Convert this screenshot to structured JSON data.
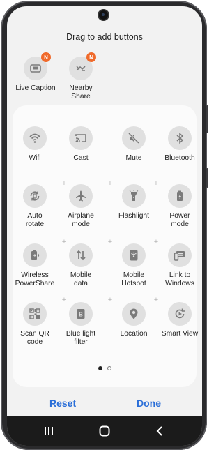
{
  "header": {
    "title": "Drag to add buttons"
  },
  "available": [
    {
      "label_lines": [
        "Live Caption"
      ],
      "badge": "N",
      "icon": "live-caption-icon"
    },
    {
      "label_lines": [
        "Nearby",
        "Share"
      ],
      "badge": "N",
      "icon": "nearby-share-icon"
    }
  ],
  "tiles": [
    {
      "label_lines": [
        "Wifi"
      ],
      "icon": "wifi-icon"
    },
    {
      "label_lines": [
        "Cast"
      ],
      "icon": "cast-icon"
    },
    {
      "label_lines": [
        "Mute"
      ],
      "icon": "mute-icon"
    },
    {
      "label_lines": [
        "Bluetooth"
      ],
      "icon": "bluetooth-icon"
    },
    {
      "label_lines": [
        "Auto",
        "rotate"
      ],
      "icon": "auto-rotate-icon"
    },
    {
      "label_lines": [
        "Airplane",
        "mode"
      ],
      "icon": "airplane-icon"
    },
    {
      "label_lines": [
        "Flashlight"
      ],
      "icon": "flashlight-icon"
    },
    {
      "label_lines": [
        "Power",
        "mode"
      ],
      "icon": "power-mode-icon"
    },
    {
      "label_lines": [
        "Wireless",
        "PowerShare"
      ],
      "icon": "wireless-powershare-icon"
    },
    {
      "label_lines": [
        "Mobile",
        "data"
      ],
      "icon": "mobile-data-icon"
    },
    {
      "label_lines": [
        "Mobile",
        "Hotspot"
      ],
      "icon": "mobile-hotspot-icon"
    },
    {
      "label_lines": [
        "Link to",
        "Windows"
      ],
      "icon": "link-to-windows-icon"
    },
    {
      "label_lines": [
        "Scan QR",
        "code"
      ],
      "icon": "qr-code-icon"
    },
    {
      "label_lines": [
        "Blue light",
        "filter"
      ],
      "icon": "blue-light-icon"
    },
    {
      "label_lines": [
        "Location"
      ],
      "icon": "location-icon"
    },
    {
      "label_lines": [
        "Smart View"
      ],
      "icon": "smart-view-icon"
    }
  ],
  "pager": {
    "pages": 2,
    "current": 1
  },
  "plus_glyph": "+",
  "footer": {
    "reset_label": "Reset",
    "done_label": "Done"
  },
  "colors": {
    "accent": "#2a6ed8",
    "badge": "#f06a2b",
    "icon": "#7a7a7a"
  }
}
